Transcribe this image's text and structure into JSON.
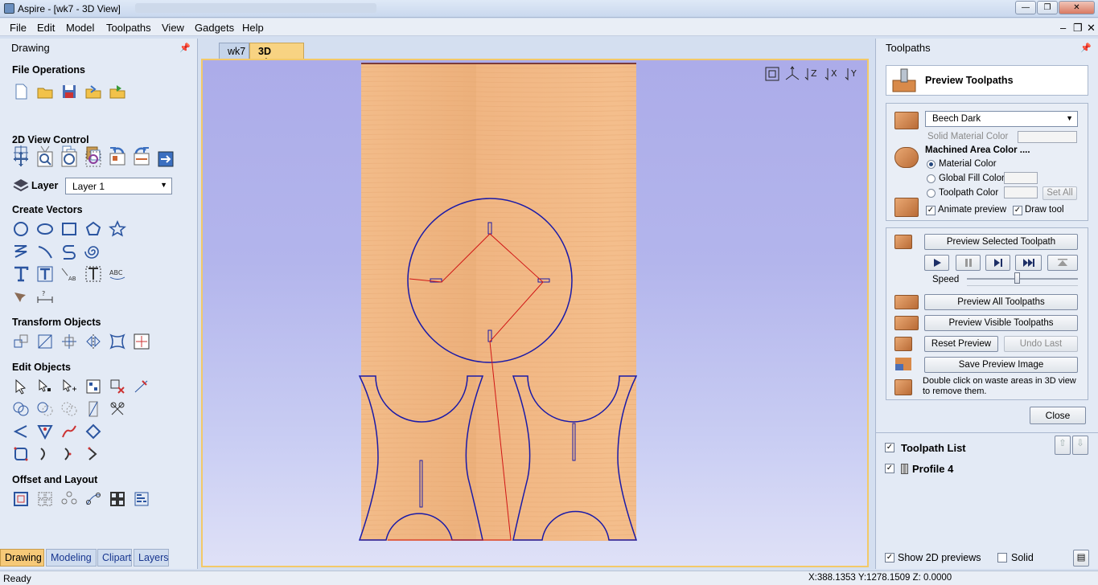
{
  "window": {
    "title": "Aspire - [wk7 - 3D View]",
    "controls": {
      "minimize": "—",
      "restore": "❐",
      "close": "✕"
    }
  },
  "menu": [
    "File",
    "Edit",
    "Model",
    "Toolpaths",
    "View",
    "Gadgets",
    "Help"
  ],
  "mdi_controls": [
    "–",
    "❐",
    "✕"
  ],
  "left_panel": {
    "title": "Drawing",
    "sections": {
      "file_ops": "File Operations",
      "view_2d": "2D View Control",
      "create_vectors": "Create Vectors",
      "transform": "Transform Objects",
      "edit": "Edit Objects",
      "offset": "Offset and Layout"
    },
    "layer_label": "Layer",
    "layer_value": "Layer 1",
    "tabs": [
      "Drawing",
      "Modeling",
      "Clipart",
      "Layers"
    ]
  },
  "center": {
    "tabs": [
      "wk7",
      "3D View"
    ],
    "view_icons": [
      "zoom-extents-icon",
      "iso-view-icon",
      "z-view-icon",
      "x-view-icon",
      "y-view-icon"
    ],
    "axis_labels": [
      "Z",
      "X",
      "Y"
    ]
  },
  "right_panel": {
    "title": "Toolpaths",
    "header": "Preview Toolpaths",
    "material": "Beech Dark",
    "solid_color_label": "Solid Material Color",
    "machined_label": "Machined Area Color ....",
    "radio_material": "Material Color",
    "radio_global": "Global Fill Color",
    "radio_toolpath": "Toolpath Color",
    "set_all": "Set All",
    "animate": "Animate preview",
    "draw_tool": "Draw tool",
    "preview_selected": "Preview Selected Toolpath",
    "speed_label": "Speed",
    "speed_value": 0.45,
    "preview_all": "Preview All Toolpaths",
    "preview_visible": "Preview Visible Toolpaths",
    "reset_preview": "Reset Preview",
    "undo_last": "Undo Last",
    "save_image": "Save Preview Image",
    "hint": "Double click on waste areas in 3D view to remove them.",
    "close": "Close",
    "toolpath_list": "Toolpath List",
    "toolpaths": [
      "Profile 4"
    ],
    "show_2d": "Show 2D previews",
    "solid": "Solid"
  },
  "status": {
    "text": "Ready",
    "coords": "X:388.1353 Y:1278.1509 Z: 0.0000"
  },
  "colors": {
    "accent": "#f3c968",
    "vector": "#1a1aa8",
    "toolpath": "#d01515",
    "wood": "#f0b27c"
  }
}
